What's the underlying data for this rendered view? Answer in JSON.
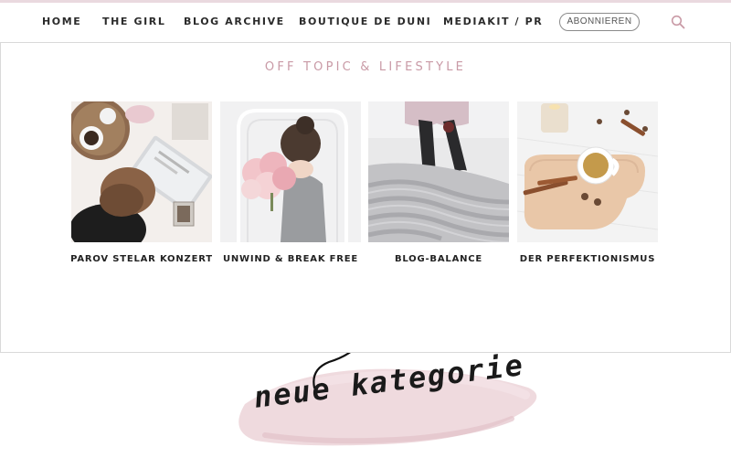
{
  "nav": {
    "items": [
      {
        "label": "HOME"
      },
      {
        "label": "THE GIRL"
      },
      {
        "label": "BLOG ARCHIVE"
      },
      {
        "label": "BOUTIQUE DE DUNI"
      },
      {
        "label": "MEDIAKIT / PR"
      }
    ],
    "subscribe_label": "ABONNIEREN",
    "search_icon": "search-icon"
  },
  "section": {
    "title": "OFF TOPIC & LIFESTYLE"
  },
  "posts": [
    {
      "title": "PAROV STELAR KONZERT"
    },
    {
      "title": "UNWIND & BREAK FREE"
    },
    {
      "title": "BLOG-BALANCE"
    },
    {
      "title": "DER PERFEKTIONISMUS"
    }
  ],
  "annotation": {
    "text": "neue kategorie"
  },
  "colors": {
    "accent": "#c99aa6",
    "top_rule": "#ead9df",
    "brush": "#ecd3d8",
    "text": "#2b2b2b"
  }
}
